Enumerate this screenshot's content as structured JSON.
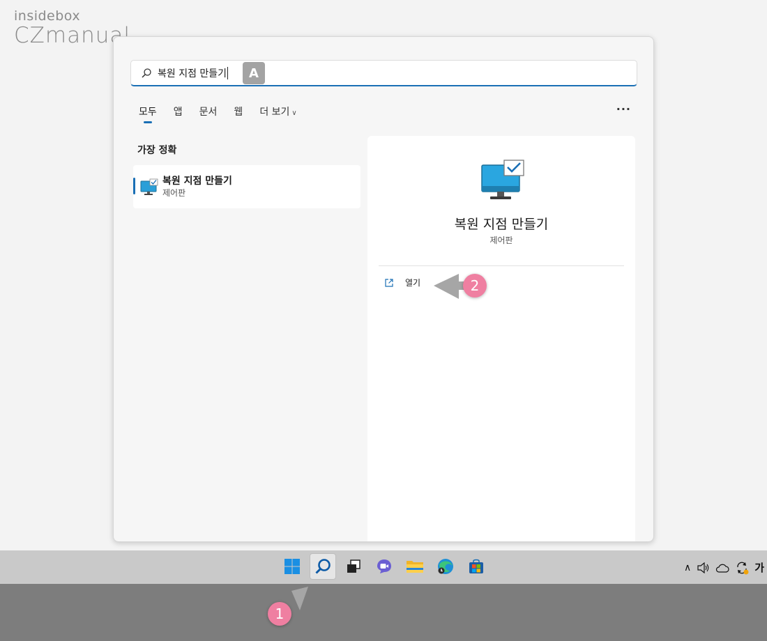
{
  "watermark": {
    "line1": "insidebox",
    "line2": "CZmanual"
  },
  "search": {
    "query": "복원 지점 만들기",
    "badge": "A"
  },
  "tabs": [
    {
      "label": "모두",
      "active": true
    },
    {
      "label": "앱",
      "active": false
    },
    {
      "label": "문서",
      "active": false
    },
    {
      "label": "웹",
      "active": false
    },
    {
      "label": "더 보기",
      "active": false
    }
  ],
  "more_label": "···",
  "best_match": {
    "section_title": "가장 정확",
    "title": "복원 지점 만들기",
    "subtitle": "제어판"
  },
  "detail": {
    "title": "복원 지점 만들기",
    "subtitle": "제어판",
    "action_label": "열기"
  },
  "annotations": {
    "step1": "1",
    "step2": "2"
  },
  "tray": {
    "ime": "가"
  },
  "colors": {
    "accent": "#1a6fb5",
    "marker": "#ef7fa1",
    "taskbar": "#c9c9c9"
  }
}
